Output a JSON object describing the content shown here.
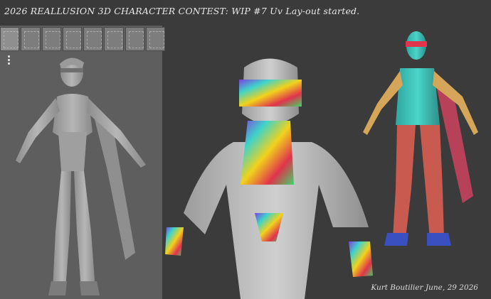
{
  "title": "2026 REALLUSION 3D CHARACTER CONTEST: WIP #7 Uv Lay-out started.",
  "footer": "Kurt Boutilier June, 29 2026",
  "uv_palette": {
    "thumb_count": 8,
    "selected_index": 0
  },
  "colors": {
    "viewport_left": "#5e5e5e",
    "viewport_right": "#3b3b3b",
    "model_gray": "#a9a9a9",
    "uv_accent_1": "#3fd3c9",
    "uv_accent_2": "#e0344c",
    "uv_accent_3": "#f1d21c",
    "uv_accent_4": "#7c3fe0"
  }
}
